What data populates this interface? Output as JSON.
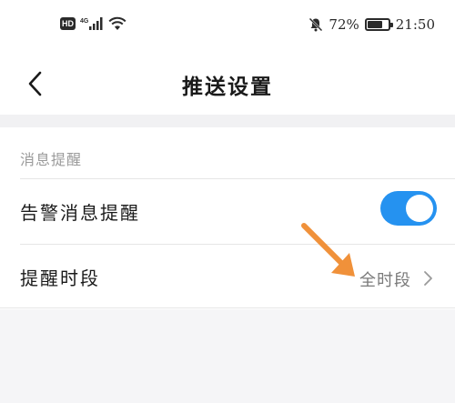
{
  "status_bar": {
    "hd_label": "HD",
    "network_label": "4G",
    "battery_percent": "72%",
    "battery_level": 0.72,
    "time": "21:50",
    "icons": [
      "hd-icon",
      "signal-icon",
      "wifi-icon",
      "mute-bell-icon",
      "battery-icon"
    ]
  },
  "nav": {
    "title": "推送设置",
    "back_icon": "chevron-left-icon"
  },
  "section": {
    "header": "消息提醒"
  },
  "rows": {
    "alarm_reminder": {
      "label": "告警消息提醒",
      "enabled": true
    },
    "reminder_period": {
      "label": "提醒时段",
      "value": "全时段"
    }
  },
  "colors": {
    "accent": "#2592f0",
    "annotation_arrow": "#f0913a",
    "background": "#f5f5f7"
  }
}
